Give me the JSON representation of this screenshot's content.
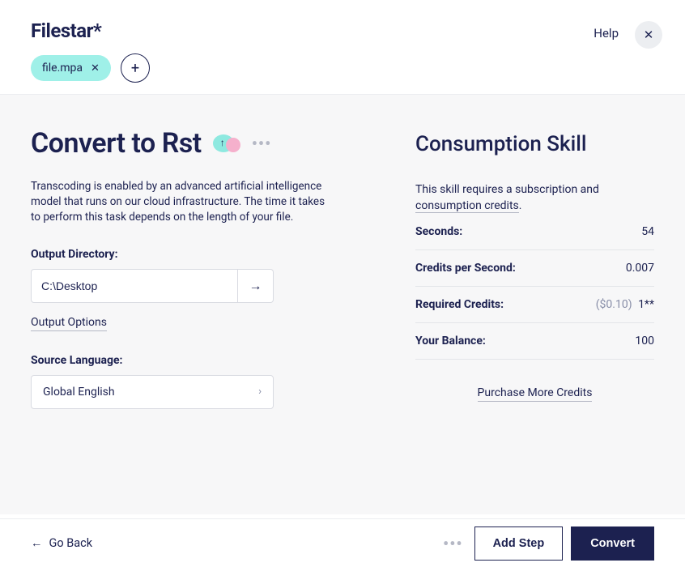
{
  "header": {
    "logo": "Filestar*",
    "help": "Help",
    "file_chip": "file.mpa"
  },
  "main": {
    "title": "Convert to Rst",
    "description": "Transcoding is enabled by an advanced artificial intelligence model that runs on our cloud infrastructure. The time it takes to perform this task depends on the length of your file.",
    "output_dir_label": "Output Directory:",
    "output_dir_value": "C:\\Desktop",
    "output_options": "Output Options",
    "source_lang_label": "Source Language:",
    "source_lang_value": "Global English"
  },
  "consumption": {
    "title": "Consumption Skill",
    "desc_pre": "This skill requires a subscription and ",
    "desc_link": "consumption credits",
    "desc_post": ".",
    "rows": {
      "seconds_label": "Seconds:",
      "seconds_value": "54",
      "cps_label": "Credits per Second:",
      "cps_value": "0.007",
      "required_label": "Required Credits:",
      "required_cost": "($0.10)",
      "required_value": "1**",
      "balance_label": "Your Balance:",
      "balance_value": "100"
    },
    "purchase": "Purchase More Credits"
  },
  "footer": {
    "go_back": "Go Back",
    "add_step": "Add Step",
    "convert": "Convert"
  }
}
